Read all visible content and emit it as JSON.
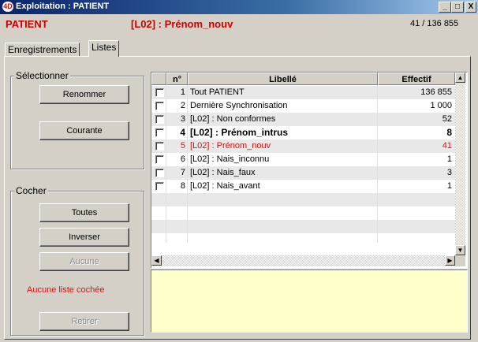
{
  "window": {
    "app_icon_text": "4D",
    "title": "Exploitation : PATIENT",
    "controls": {
      "minimize": "_",
      "maximize": "□",
      "close": "X"
    }
  },
  "header": {
    "table_name": "PATIENT",
    "selection_name": "[L02] : Prénom_nouv",
    "count": "41 / 136 855"
  },
  "tabs": [
    {
      "label": "Enregistrements",
      "active": false
    },
    {
      "label": "Listes",
      "active": true
    }
  ],
  "select_group": {
    "title": "Sélectionner",
    "rename_label": "Renommer",
    "current_label": "Courante"
  },
  "check_group": {
    "title": "Cocher",
    "all_label": "Toutes",
    "invert_label": "Inverser",
    "none_label": "Aucune",
    "status_text": "Aucune liste cochée",
    "remove_label": "Retirer"
  },
  "list": {
    "columns": {
      "num": "n°",
      "label": "Libellé",
      "count": "Effectif"
    },
    "rows": [
      {
        "n": "1",
        "label": "Tout PATIENT",
        "count": "136 855",
        "style": "normal"
      },
      {
        "n": "2",
        "label": "Dernière Synchronisation",
        "count": "1 000",
        "style": "normal"
      },
      {
        "n": "3",
        "label": "[L02] : Non conformes",
        "count": "52",
        "style": "normal"
      },
      {
        "n": "4",
        "label": "[L02] : Prénom_intrus",
        "count": "8",
        "style": "bold"
      },
      {
        "n": "5",
        "label": "[L02] : Prénom_nouv",
        "count": "41",
        "style": "red"
      },
      {
        "n": "6",
        "label": "[L02] : Nais_inconnu",
        "count": "1",
        "style": "normal"
      },
      {
        "n": "7",
        "label": "[L02] : Nais_faux",
        "count": "3",
        "style": "normal"
      },
      {
        "n": "8",
        "label": "[L02] : Nais_avant",
        "count": "1",
        "style": "normal"
      }
    ]
  },
  "colors": {
    "titlebar": "#0a246a",
    "accent_red": "#cc0000",
    "note_bg": "#ffffcc",
    "face": "#d4d0c8"
  },
  "icons": {
    "scroll_up": "scroll-up-arrow-icon",
    "scroll_down": "scroll-down-arrow-icon",
    "scroll_left": "scroll-left-arrow-icon",
    "scroll_right": "scroll-right-arrow-icon"
  }
}
